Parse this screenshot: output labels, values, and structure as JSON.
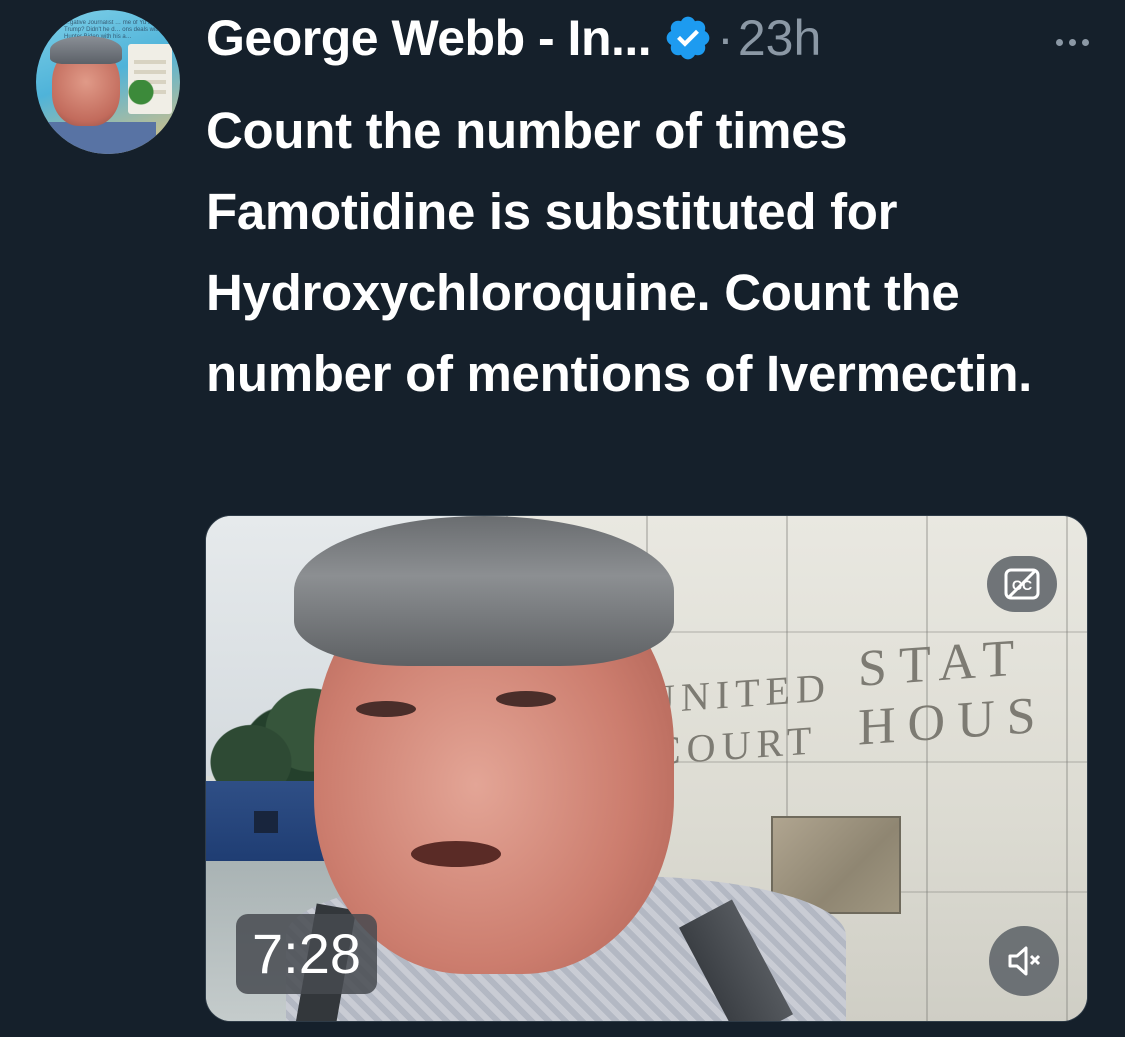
{
  "author": {
    "display_name": "George Webb - In...",
    "verified_icon": "verified-badge-icon",
    "timestamp": "23h",
    "separator": "·"
  },
  "avatar": {
    "background_text": "…gative Journalist … me of Yu to Trump? Didn't he d… ons deals with Hunter Biden with his a…"
  },
  "tweet": {
    "text": "Count the number of times Famotidine is substituted for Hydroxychloroquine. Count the number of mentions of Ivermectin."
  },
  "media": {
    "type": "video",
    "duration": "7:28",
    "captions_icon": "closed-captions-off-icon",
    "mute_icon": "speaker-muted-icon",
    "building_text_row1_left": "UNITED",
    "building_text_row1_right": "STAT",
    "building_text_row2_left": "COURT",
    "building_text_row2_right": "HOUS"
  },
  "colors": {
    "background": "#15202b",
    "primary_text": "#ffffff",
    "secondary_text": "#8b98a5",
    "verified_blue": "#1d9bf0"
  }
}
